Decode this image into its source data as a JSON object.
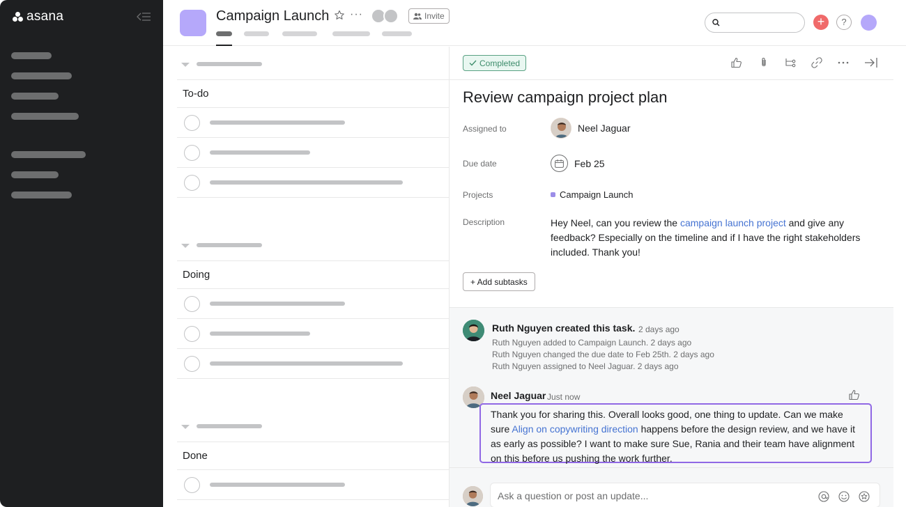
{
  "app": {
    "brand": "asana"
  },
  "header": {
    "project_title": "Campaign Launch",
    "invite_label": "Invite",
    "more_label": "···",
    "plus_label": "+",
    "help_label": "?"
  },
  "list": {
    "sections": [
      {
        "title": "To-do"
      },
      {
        "title": "Doing"
      },
      {
        "title": "Done"
      }
    ]
  },
  "detail": {
    "completed_label": "Completed",
    "task_title": "Review campaign project plan",
    "fields": {
      "assigned_label": "Assigned to",
      "assigned_value": "Neel Jaguar",
      "due_label": "Due date",
      "due_value": "Feb 25",
      "projects_label": "Projects",
      "projects_value": "Campaign Launch",
      "description_label": "Description"
    },
    "description": {
      "before": "Hey Neel, can you review the ",
      "link": "campaign launch project",
      "after": " and give any feedback? Especially on the timeline and if I have the right stakeholders included. Thank you!"
    },
    "add_subtasks_label": "+ Add subtasks"
  },
  "activity": {
    "creator_line": "Ruth Nguyen created this task.",
    "creator_time": "2 days ago",
    "lines": [
      "Ruth Nguyen added to Campaign Launch. 2 days ago",
      "Ruth Nguyen changed the due date to Feb 25th. 2 days ago",
      "Ruth Nguyen assigned to Neel Jaguar. 2 days ago"
    ]
  },
  "comment": {
    "author": "Neel Jaguar",
    "time": "Just now",
    "text_before": "Thank you for sharing this. Overall looks good, one thing to update. Can we make sure ",
    "link": "Align on copywriting direction",
    "text_after": " happens before the design review, and we have it as early as possible? I want to make sure Sue, Rania and their team have alignment on this before us pushing the work further."
  },
  "composer": {
    "placeholder": "Ask a question or post an update..."
  },
  "colors": {
    "sidebar_bg": "#1e1f21",
    "project_icon": "#b5a8fa",
    "completed_green": "#58a182",
    "link_blue": "#4573d2",
    "comment_highlight": "#9068e5",
    "plus_button": "#f06a6a"
  }
}
